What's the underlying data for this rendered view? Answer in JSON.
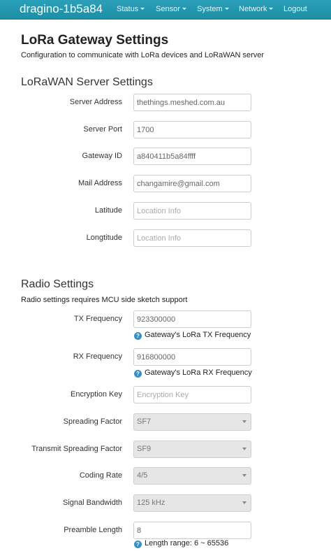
{
  "navbar": {
    "brand": "dragino-1b5a84",
    "items": [
      {
        "label": "Status"
      },
      {
        "label": "Sensor"
      },
      {
        "label": "System"
      },
      {
        "label": "Network"
      },
      {
        "label": "Logout"
      }
    ]
  },
  "page": {
    "title": "LoRa Gateway Settings",
    "description": "Configuration to communicate with LoRa devices and LoRaWAN server"
  },
  "lorawan": {
    "title": "LoRaWAN Server Settings",
    "server_address": {
      "label": "Server Address",
      "value": "thethings.meshed.com.au",
      "placeholder": ""
    },
    "server_port": {
      "label": "Server Port",
      "value": "1700",
      "placeholder": ""
    },
    "gateway_id": {
      "label": "Gateway ID",
      "value": "a840411b5a84ffff",
      "placeholder": ""
    },
    "mail_address": {
      "label": "Mail Address",
      "value": "changamire@gmail.com",
      "placeholder": ""
    },
    "latitude": {
      "label": "Latitude",
      "value": "",
      "placeholder": "Location Info"
    },
    "longtitude": {
      "label": "Longtitude",
      "value": "",
      "placeholder": "Location Info"
    }
  },
  "radio": {
    "title": "Radio Settings",
    "description": "Radio settings requires MCU side sketch support",
    "tx_frequency": {
      "label": "TX Frequency",
      "value": "923300000",
      "help": "Gateway's LoRa TX Frequency"
    },
    "rx_frequency": {
      "label": "RX Frequency",
      "value": "916800000",
      "help": "Gateway's LoRa RX Frequency"
    },
    "encryption_key": {
      "label": "Encryption Key",
      "value": "",
      "placeholder": "Encryption Key"
    },
    "spreading_factor": {
      "label": "Spreading Factor",
      "selected": "SF7"
    },
    "transmit_spreading_factor": {
      "label": "Transmit Spreading Factor",
      "selected": "SF9"
    },
    "coding_rate": {
      "label": "Coding Rate",
      "selected": "4/5"
    },
    "signal_bandwidth": {
      "label": "Signal Bandwidth",
      "selected": "125 kHz"
    },
    "preamble_length": {
      "label": "Preamble Length",
      "value": "8",
      "help": "Length range: 6 ~ 65536"
    }
  },
  "icons": {
    "help": "question-circle-icon",
    "caret": "caret-down-icon"
  },
  "colors": {
    "navbar": "#1d8ea6",
    "help_icon": "#3a8ec8"
  }
}
